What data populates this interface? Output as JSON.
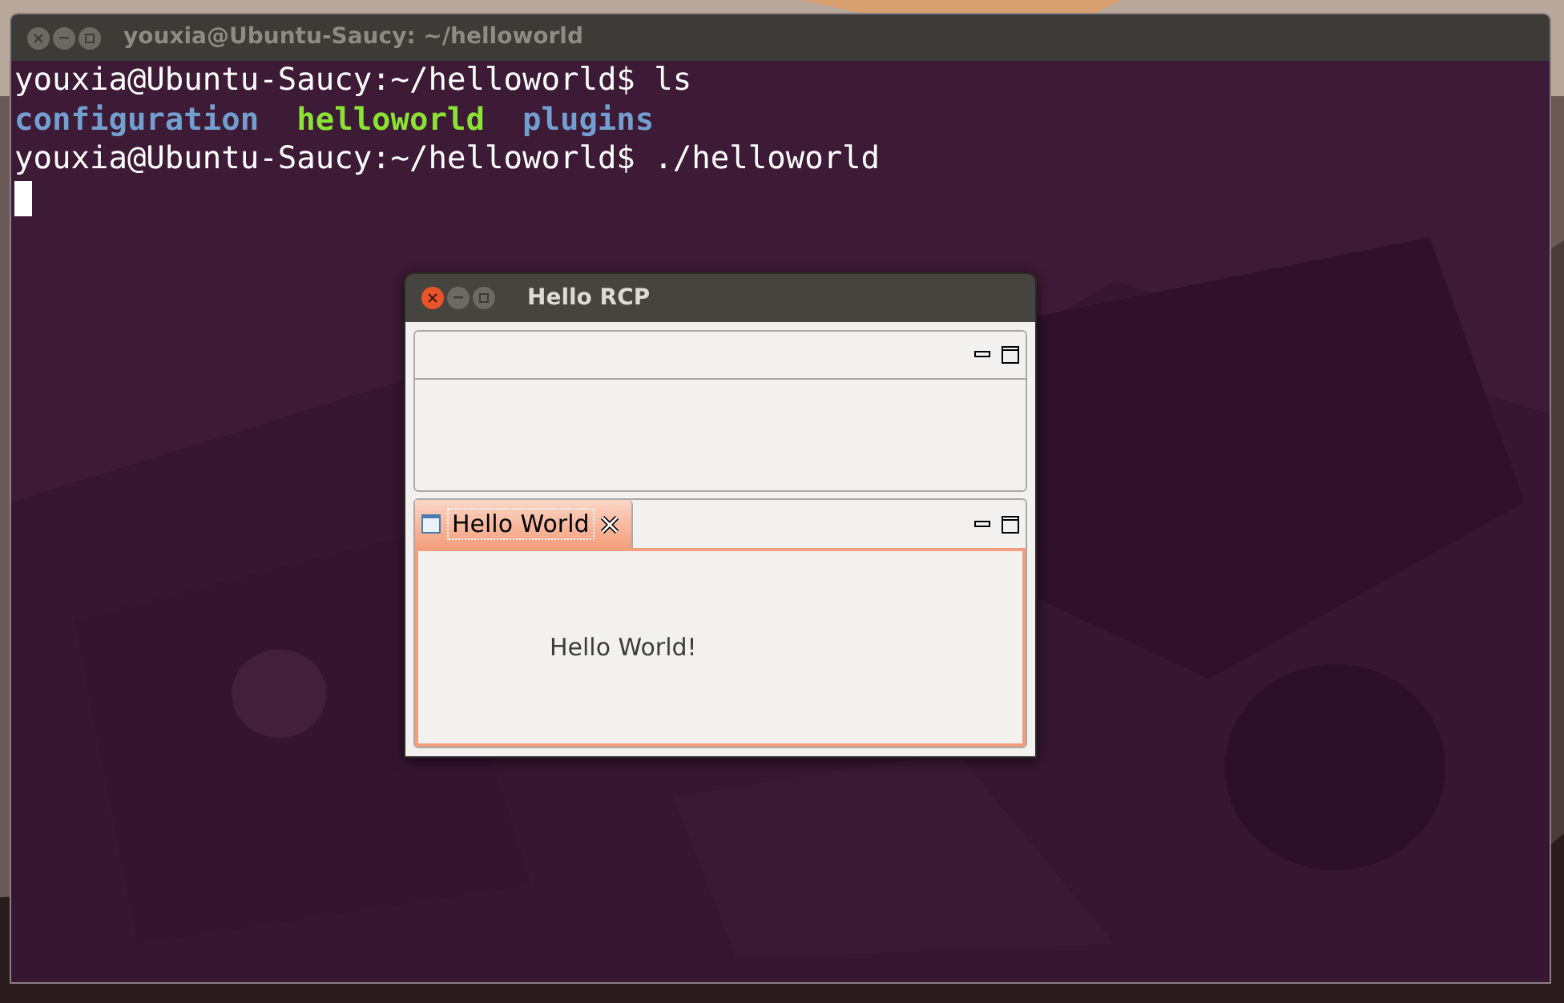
{
  "terminal": {
    "title": "youxia@Ubuntu-Saucy: ~/helloworld",
    "focused": false,
    "lines": [
      {
        "segments": [
          {
            "text": "youxia@Ubuntu-Saucy:~/helloworld$ ls",
            "kind": "plain"
          }
        ]
      },
      {
        "segments": [
          {
            "text": "configuration",
            "kind": "directory"
          },
          {
            "text": "helloworld",
            "kind": "executable"
          },
          {
            "text": "plugins",
            "kind": "directory"
          }
        ]
      },
      {
        "segments": [
          {
            "text": "youxia@Ubuntu-Saucy:~/helloworld$ ./helloworld",
            "kind": "plain"
          }
        ]
      }
    ],
    "cursor_visible": true
  },
  "rcp_window": {
    "title": "Hello RCP",
    "focused": true,
    "views": [
      {
        "kind": "empty"
      },
      {
        "kind": "tabbed",
        "tabs": [
          {
            "label": "Hello World",
            "selected": true
          }
        ],
        "content": "Hello World!"
      }
    ]
  }
}
